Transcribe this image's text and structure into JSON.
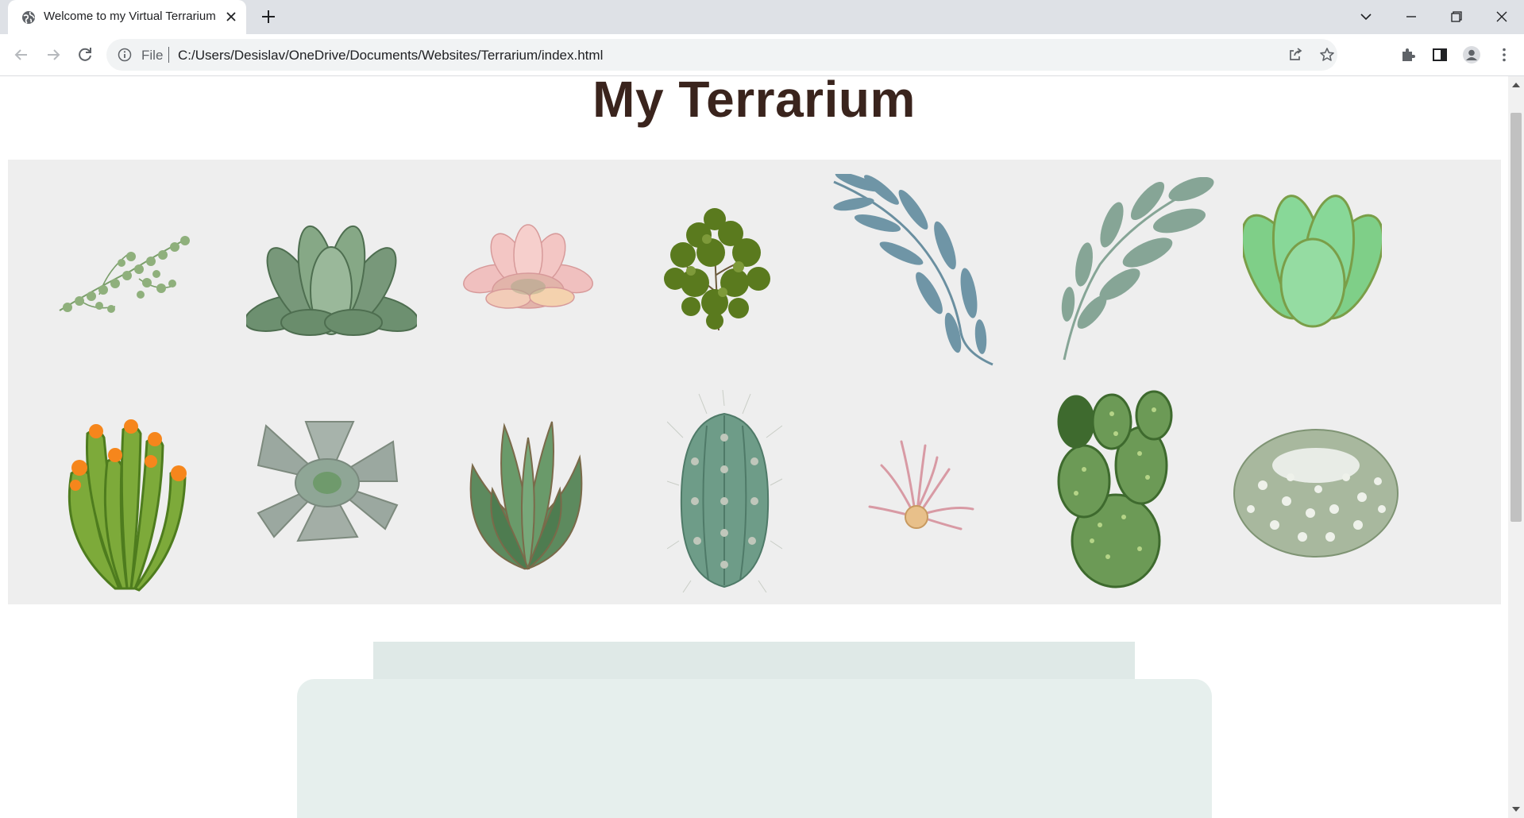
{
  "browser": {
    "tab": {
      "title": "Welcome to my Virtual Terrarium"
    },
    "address_bar": {
      "scheme_label": "File",
      "url": "C:/Users/Desislav/OneDrive/Documents/Websites/Terrarium/index.html"
    }
  },
  "page": {
    "title": "My Terrarium",
    "plants": [
      {
        "name": "string-of-pearls-plant",
        "row": 1
      },
      {
        "name": "green-echeveria-plant",
        "row": 1
      },
      {
        "name": "pink-succulent-plant",
        "row": 1
      },
      {
        "name": "leafy-shrub-plant",
        "row": 1
      },
      {
        "name": "blue-eucalyptus-branch-plant",
        "row": 1
      },
      {
        "name": "sage-eucalyptus-branch-plant",
        "row": 1
      },
      {
        "name": "jade-succulent-plant",
        "row": 1
      },
      {
        "name": "flowering-cactus-plant",
        "row": 2
      },
      {
        "name": "gray-rosette-plant",
        "row": 2
      },
      {
        "name": "aloe-plant",
        "row": 2
      },
      {
        "name": "columnar-cactus-plant",
        "row": 2
      },
      {
        "name": "air-plant",
        "row": 2
      },
      {
        "name": "prickly-pear-cactus-plant",
        "row": 2
      },
      {
        "name": "barrel-cactus-plant",
        "row": 2
      }
    ]
  },
  "colors": {
    "title": "#3a241d",
    "plant_holder": "#eeeeee",
    "jar_top": "#dfe9e7",
    "jar_body": "#e6efed"
  }
}
